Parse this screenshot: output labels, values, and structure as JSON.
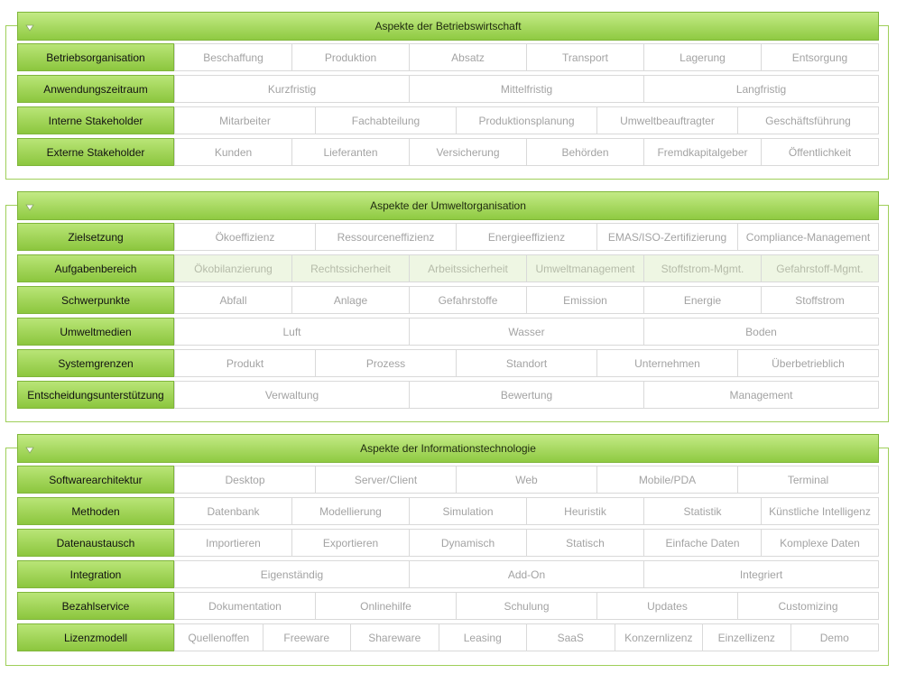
{
  "panels": [
    {
      "title": "Aspekte der Betriebswirtschaft",
      "rows": [
        {
          "label": "Betriebsorganisation",
          "options": [
            "Beschaffung",
            "Produktion",
            "Absatz",
            "Transport",
            "Lagerung",
            "Entsorgung"
          ]
        },
        {
          "label": "Anwendungszeitraum",
          "options": [
            "Kurzfristig",
            "Mittelfristig",
            "Langfristig"
          ]
        },
        {
          "label": "Interne Stakeholder",
          "options": [
            "Mitarbeiter",
            "Fachabteilung",
            "Produktionsplanung",
            "Umweltbeauftragter",
            "Geschäftsführung"
          ]
        },
        {
          "label": "Externe Stakeholder",
          "options": [
            "Kunden",
            "Lieferanten",
            "Versicherung",
            "Behörden",
            "Fremdkapitalgeber",
            "Öffentlichkeit"
          ]
        }
      ]
    },
    {
      "title": "Aspekte der Umweltorganisation",
      "rows": [
        {
          "label": "Zielsetzung",
          "options": [
            "Ökoeffizienz",
            "Ressourceneffizienz",
            "Energieeffizienz",
            "EMAS/ISO-Zertifizierung",
            "Compliance-Management"
          ]
        },
        {
          "label": "Aufgabenbereich",
          "highlighted": true,
          "options": [
            "Ökobilanzierung",
            "Rechtssicherheit",
            "Arbeitssicherheit",
            "Umweltmanagement",
            "Stoffstrom-Mgmt.",
            "Gefahrstoff-Mgmt."
          ]
        },
        {
          "label": "Schwerpunkte",
          "options": [
            "Abfall",
            "Anlage",
            "Gefahrstoffe",
            "Emission",
            "Energie",
            "Stoffstrom"
          ]
        },
        {
          "label": "Umweltmedien",
          "options": [
            "Luft",
            "Wasser",
            "Boden"
          ]
        },
        {
          "label": "Systemgrenzen",
          "options": [
            "Produkt",
            "Prozess",
            "Standort",
            "Unternehmen",
            "Überbetrieblich"
          ]
        },
        {
          "label": "Entscheidungsunterstützung",
          "options": [
            "Verwaltung",
            "Bewertung",
            "Management"
          ]
        }
      ]
    },
    {
      "title": "Aspekte der Informationstechnologie",
      "rows": [
        {
          "label": "Softwarearchitektur",
          "options": [
            "Desktop",
            "Server/Client",
            "Web",
            "Mobile/PDA",
            "Terminal"
          ]
        },
        {
          "label": "Methoden",
          "options": [
            "Datenbank",
            "Modellierung",
            "Simulation",
            "Heuristik",
            "Statistik",
            "Künstliche Intelligenz"
          ]
        },
        {
          "label": "Datenaustausch",
          "options": [
            "Importieren",
            "Exportieren",
            "Dynamisch",
            "Statisch",
            "Einfache Daten",
            "Komplexe Daten"
          ]
        },
        {
          "label": "Integration",
          "options": [
            "Eigenständig",
            "Add-On",
            "Integriert"
          ]
        },
        {
          "label": "Bezahlservice",
          "options": [
            "Dokumentation",
            "Onlinehilfe",
            "Schulung",
            "Updates",
            "Customizing"
          ]
        },
        {
          "label": "Lizenzmodell",
          "options": [
            "Quellenoffen",
            "Freeware",
            "Shareware",
            "Leasing",
            "SaaS",
            "Konzernlizenz",
            "Einzellizenz",
            "Demo"
          ]
        }
      ]
    }
  ]
}
